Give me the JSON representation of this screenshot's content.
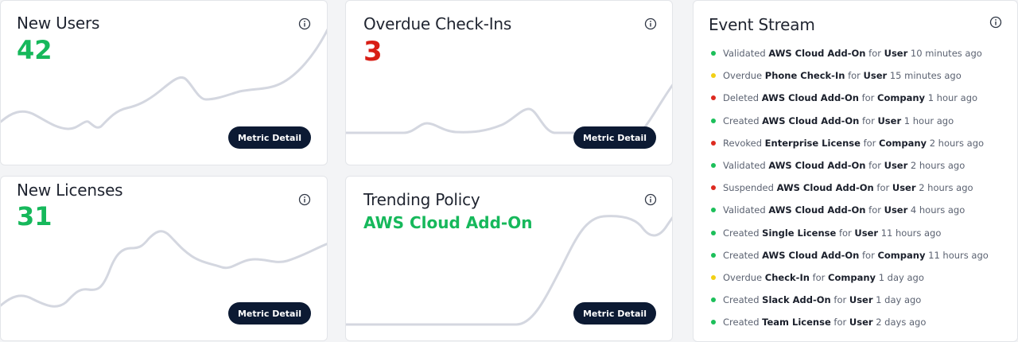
{
  "colors": {
    "green": "#16b85b",
    "red": "#d81e15",
    "navy": "#0c1a33",
    "line": "#d4d7e0",
    "dot_green": "#1cbf5a",
    "dot_red": "#dd2a20",
    "dot_yellow": "#f2d015"
  },
  "cards": {
    "new_users": {
      "title": "New Users",
      "value": "42",
      "button": "Metric Detail"
    },
    "overdue_checkins": {
      "title": "Overdue Check-Ins",
      "value": "3",
      "button": "Metric Detail"
    },
    "new_licenses": {
      "title": "New Licenses",
      "value": "31",
      "button": "Metric Detail"
    },
    "trending_policy": {
      "title": "Trending Policy",
      "value": "AWS Cloud Add-On",
      "button": "Metric Detail"
    }
  },
  "event_stream": {
    "title": "Event Stream",
    "items": [
      {
        "status": "green",
        "action": "Validated",
        "item": "AWS Cloud Add-On",
        "prep": "for",
        "target": "User",
        "time": "10 minutes ago"
      },
      {
        "status": "yellow",
        "action": "Overdue",
        "item": "Phone Check-In",
        "prep": "for",
        "target": "User",
        "time": "15 minutes ago"
      },
      {
        "status": "red",
        "action": "Deleted",
        "item": "AWS Cloud Add-On",
        "prep": "for",
        "target": "Company",
        "time": "1 hour ago"
      },
      {
        "status": "green",
        "action": "Created",
        "item": "AWS Cloud Add-On",
        "prep": "for",
        "target": "User",
        "time": "1 hour ago"
      },
      {
        "status": "red",
        "action": "Revoked",
        "item": "Enterprise License",
        "prep": "for",
        "target": "Company",
        "time": "2 hours ago"
      },
      {
        "status": "green",
        "action": "Validated",
        "item": "AWS Cloud Add-On",
        "prep": "for",
        "target": "User",
        "time": "2 hours ago"
      },
      {
        "status": "red",
        "action": "Suspended",
        "item": "AWS Cloud Add-On",
        "prep": "for",
        "target": "User",
        "time": "2 hours ago"
      },
      {
        "status": "green",
        "action": "Validated",
        "item": "AWS Cloud Add-On",
        "prep": "for",
        "target": "User",
        "time": "4 hours ago"
      },
      {
        "status": "green",
        "action": "Created",
        "item": "Single License",
        "prep": "for",
        "target": "User",
        "time": "11 hours ago"
      },
      {
        "status": "green",
        "action": "Created",
        "item": "AWS Cloud Add-On",
        "prep": "for",
        "target": "Company",
        "time": "11 hours ago"
      },
      {
        "status": "yellow",
        "action": "Overdue",
        "item": "Check-In",
        "prep": "for",
        "target": "Company",
        "time": "1 day ago"
      },
      {
        "status": "green",
        "action": "Created",
        "item": "Slack Add-On",
        "prep": "for",
        "target": "User",
        "time": "1 day ago"
      },
      {
        "status": "green",
        "action": "Created",
        "item": "Team License",
        "prep": "for",
        "target": "User",
        "time": "2 days ago"
      }
    ]
  }
}
